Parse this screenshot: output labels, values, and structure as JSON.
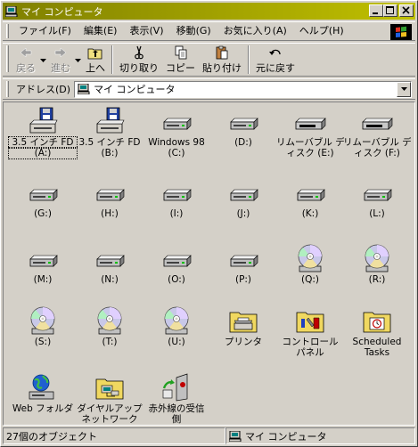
{
  "window": {
    "title": "マイ コンピュータ"
  },
  "menubar": {
    "items": [
      "ファイル(F)",
      "編集(E)",
      "表示(V)",
      "移動(G)",
      "お気に入り(A)",
      "ヘルプ(H)"
    ]
  },
  "toolbar": {
    "back": "戻る",
    "forward": "進む",
    "up": "上へ",
    "cut": "切り取り",
    "copy": "コピー",
    "paste": "貼り付け",
    "undo": "元に戻す"
  },
  "address": {
    "label": "アドレス(D)",
    "value": "マイ コンピュータ"
  },
  "items": [
    {
      "l1": "3.5 インチ FD",
      "l2": "(A:)",
      "icon": "floppy-drive-icon"
    },
    {
      "l1": "3.5 インチ FD",
      "l2": "(B:)",
      "icon": "floppy-drive-icon"
    },
    {
      "l1": "Windows 98",
      "l2": "(C:)",
      "icon": "hard-drive-icon"
    },
    {
      "l1": "(D:)",
      "l2": "",
      "icon": "hard-drive-icon"
    },
    {
      "l1": "リムーバブル デ",
      "l2": "ィスク (E:)",
      "icon": "removable-disk-icon"
    },
    {
      "l1": "リムーバブル デ",
      "l2": "ィスク (F:)",
      "icon": "removable-disk-icon"
    },
    {
      "l1": "(G:)",
      "l2": "",
      "icon": "hard-drive-icon"
    },
    {
      "l1": "(H:)",
      "l2": "",
      "icon": "hard-drive-icon"
    },
    {
      "l1": "(I:)",
      "l2": "",
      "icon": "hard-drive-icon"
    },
    {
      "l1": "(J:)",
      "l2": "",
      "icon": "hard-drive-icon"
    },
    {
      "l1": "(K:)",
      "l2": "",
      "icon": "hard-drive-icon"
    },
    {
      "l1": "(L:)",
      "l2": "",
      "icon": "hard-drive-icon"
    },
    {
      "l1": "(M:)",
      "l2": "",
      "icon": "hard-drive-icon"
    },
    {
      "l1": "(N:)",
      "l2": "",
      "icon": "hard-drive-icon"
    },
    {
      "l1": "(O:)",
      "l2": "",
      "icon": "hard-drive-icon"
    },
    {
      "l1": "(P:)",
      "l2": "",
      "icon": "hard-drive-icon"
    },
    {
      "l1": "(Q:)",
      "l2": "",
      "icon": "cd-drive-icon"
    },
    {
      "l1": "(R:)",
      "l2": "",
      "icon": "cd-drive-icon"
    },
    {
      "l1": "(S:)",
      "l2": "",
      "icon": "cd-drive-icon"
    },
    {
      "l1": "(T:)",
      "l2": "",
      "icon": "cd-drive-icon"
    },
    {
      "l1": "(U:)",
      "l2": "",
      "icon": "cd-drive-icon"
    },
    {
      "l1": "プリンタ",
      "l2": "",
      "icon": "printers-folder-icon"
    },
    {
      "l1": "コントロール",
      "l2": "パネル",
      "icon": "control-panel-folder-icon"
    },
    {
      "l1": "Scheduled",
      "l2": "Tasks",
      "icon": "scheduled-tasks-folder-icon"
    },
    {
      "l1": "Web フォルダ",
      "l2": "",
      "icon": "web-folders-icon"
    },
    {
      "l1": "ダイヤルアップ",
      "l2": "ネットワーク",
      "icon": "dialup-networking-folder-icon"
    },
    {
      "l1": "赤外線の受信",
      "l2": "側",
      "icon": "infrared-recipient-icon"
    }
  ],
  "status": {
    "count": "27個のオブジェクト",
    "location": "マイ コンピュータ"
  }
}
